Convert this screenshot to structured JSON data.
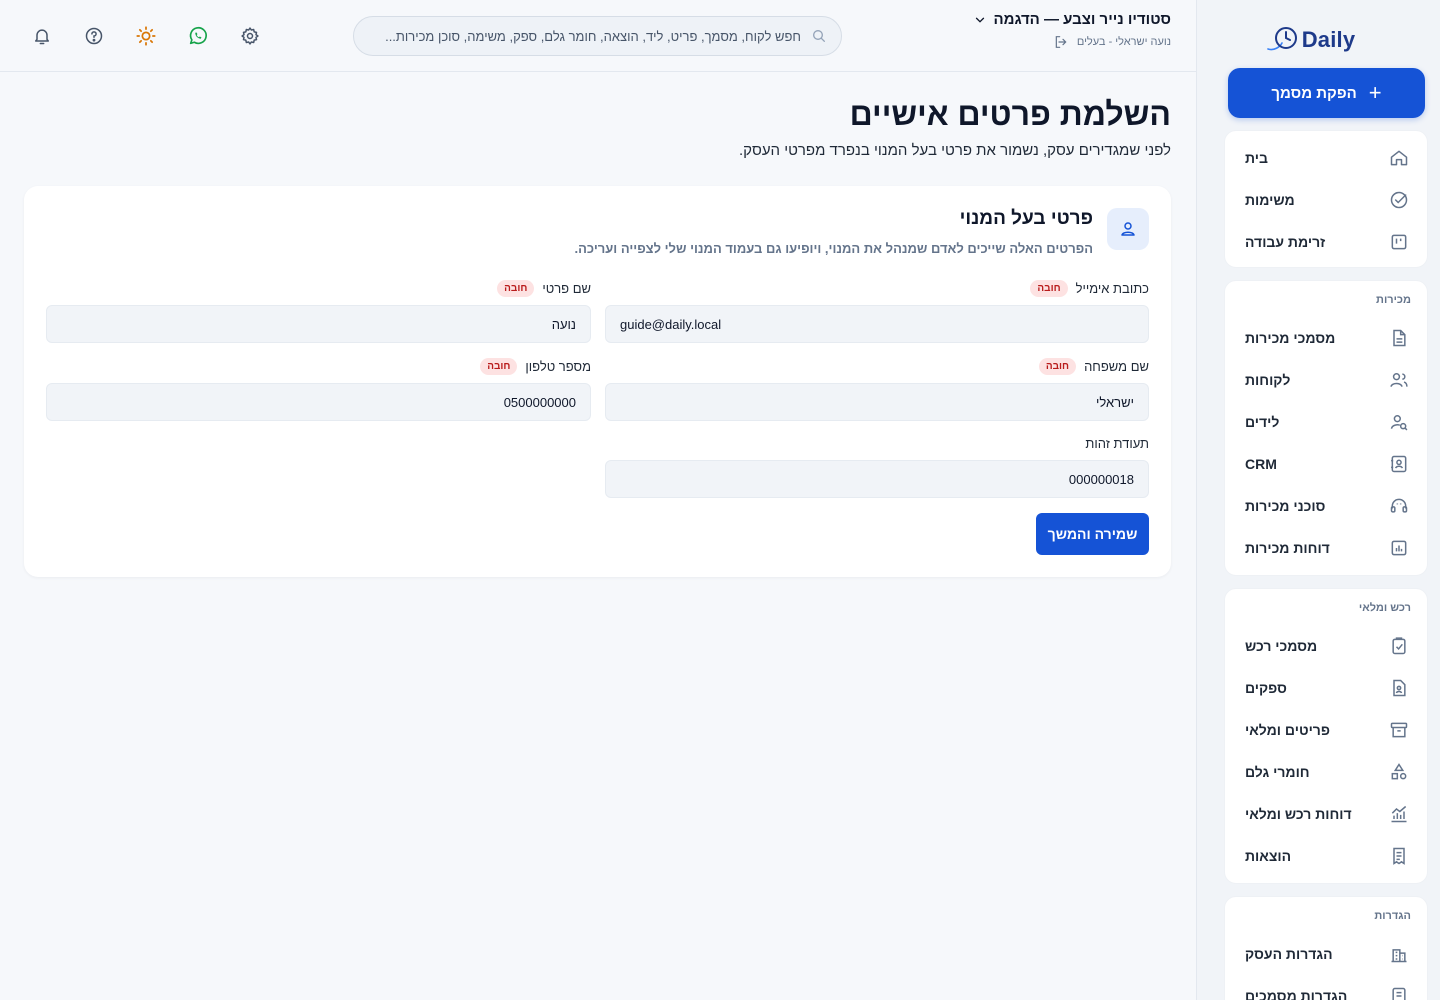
{
  "app": {
    "logo_text": "Daily"
  },
  "sidebar": {
    "new_doc_label": "הפקת מסמך",
    "main_items": [
      {
        "label": "בית",
        "icon": "home-icon"
      },
      {
        "label": "משימות",
        "icon": "check-circle-icon"
      },
      {
        "label": "זרימת עבודה",
        "icon": "kanban-icon"
      }
    ],
    "sales": {
      "title": "מכירות",
      "items": [
        {
          "label": "מסמכי מכירות",
          "icon": "document-icon"
        },
        {
          "label": "לקוחות",
          "icon": "users-icon"
        },
        {
          "label": "לידים",
          "icon": "user-search-icon"
        },
        {
          "label": "CRM",
          "icon": "contact-card-icon"
        },
        {
          "label": "סוכני מכירות",
          "icon": "headset-icon"
        },
        {
          "label": "דוחות מכירות",
          "icon": "bar-report-icon"
        }
      ]
    },
    "procurement": {
      "title": "רכש ומלאי",
      "items": [
        {
          "label": "מסמכי רכש",
          "icon": "clipboard-check-icon"
        },
        {
          "label": "ספקים",
          "icon": "supplier-icon"
        },
        {
          "label": "פריטים ומלאי",
          "icon": "archive-icon"
        },
        {
          "label": "חומרי גלם",
          "icon": "shapes-icon"
        },
        {
          "label": "דוחות רכש ומלאי",
          "icon": "line-report-icon"
        },
        {
          "label": "הוצאות",
          "icon": "receipt-icon"
        }
      ]
    },
    "settings": {
      "title": "הגדרות",
      "items": [
        {
          "label": "הגדרות העסק",
          "icon": "building-icon"
        },
        {
          "label": "הגדרות מסמכים",
          "icon": "doc-settings-icon"
        }
      ]
    }
  },
  "header": {
    "business_name": "סטודיו נייר וצבע — הדגמה",
    "user_line": "נועה ישראלי - בעלים",
    "search_placeholder": "חפש לקוח, מסמך, פריט, ליד, הוצאה, חומר גלם, ספק, משימה, סוכן מכירות..."
  },
  "page": {
    "title": "השלמת פרטים אישיים",
    "subtitle": "לפני שמגדירים עסק, נשמור את פרטי בעל המנוי בנפרד מפרטי העסק."
  },
  "card": {
    "title": "פרטי בעל המנוי",
    "subtitle": "הפרטים האלה שייכים לאדם שמנהל את המנוי, ויופיעו גם בעמוד המנוי שלי לצפייה ועריכה.",
    "required_badge": "חובה",
    "fields": {
      "first_name": {
        "label": "שם פרטי",
        "value": "נועה"
      },
      "email": {
        "label": "כתובת אימייל",
        "value": "guide@daily.local"
      },
      "phone": {
        "label": "מספר טלפון",
        "value": "0500000000"
      },
      "last_name": {
        "label": "שם משפחה",
        "value": "ישראלי"
      },
      "id_number": {
        "label": "תעודת זהות",
        "value": "000000018"
      }
    },
    "save_label": "שמירה והמשך"
  },
  "colors": {
    "accent": "#1553d6",
    "whatsapp": "#16a34a",
    "sun": "#d97706",
    "required_bg": "#fde2e2",
    "required_text": "#b91c1c"
  }
}
